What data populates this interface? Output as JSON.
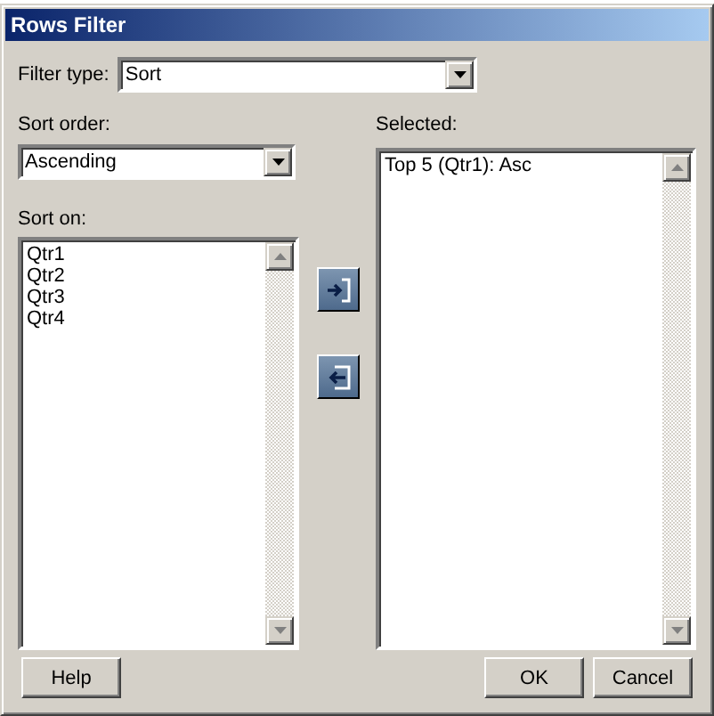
{
  "window": {
    "title": "Rows Filter"
  },
  "filter_type": {
    "label": "Filter type:",
    "value": "Sort"
  },
  "sort_order": {
    "label": "Sort order:",
    "value": "Ascending"
  },
  "sort_on": {
    "label": "Sort on:",
    "items": [
      "Qtr1",
      "Qtr2",
      "Qtr3",
      "Qtr4"
    ]
  },
  "selected": {
    "label": "Selected:",
    "items": [
      "Top 5 (Qtr1): Asc"
    ]
  },
  "buttons": {
    "help": "Help",
    "ok": "OK",
    "cancel": "Cancel"
  }
}
